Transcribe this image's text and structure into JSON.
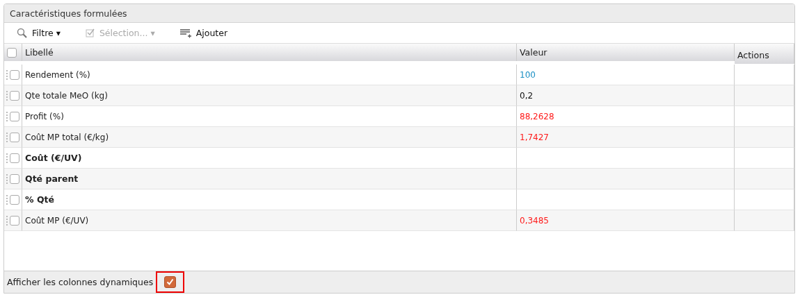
{
  "panel": {
    "title": "Caractéristiques formulées"
  },
  "toolbar": [
    {
      "kind": "search",
      "label": "Filtre",
      "caret": "▾",
      "disabled": false
    },
    {
      "kind": "check",
      "label": "Sélection...",
      "caret": "▾",
      "disabled": true
    },
    {
      "kind": "add",
      "label": "Ajouter",
      "disabled": false
    }
  ],
  "table": {
    "columns": [
      "Libellé",
      "Valeur",
      "Actions"
    ],
    "all_checked": false,
    "rows": [
      {
        "label": "Rendement (%)",
        "value": "100",
        "color": "#1a8fc4",
        "bold": false,
        "checked": false
      },
      {
        "label": "Qte totale MeO (kg)",
        "value": "0,2",
        "color": "#111111",
        "bold": false,
        "checked": false
      },
      {
        "label": "Profit (%)",
        "value": "88,2628",
        "color": "#ff1a1a",
        "bold": false,
        "checked": false
      },
      {
        "label": "Coût MP total (€/kg)",
        "value": "1,7427",
        "color": "#ff1a1a",
        "bold": false,
        "checked": false
      },
      {
        "label": "Coût (€/UV)",
        "bold": true,
        "checked": false
      },
      {
        "label": "Qté parent",
        "bold": true,
        "checked": false
      },
      {
        "label": "% Qté",
        "bold": true,
        "checked": false
      },
      {
        "label": "Coût MP (€/UV)",
        "value": "0,3485",
        "color": "#ff1a1a",
        "bold": false,
        "checked": false
      }
    ]
  },
  "footer": {
    "label": "Afficher les colonnes dynamiques",
    "checked": true,
    "highlighted": true
  }
}
